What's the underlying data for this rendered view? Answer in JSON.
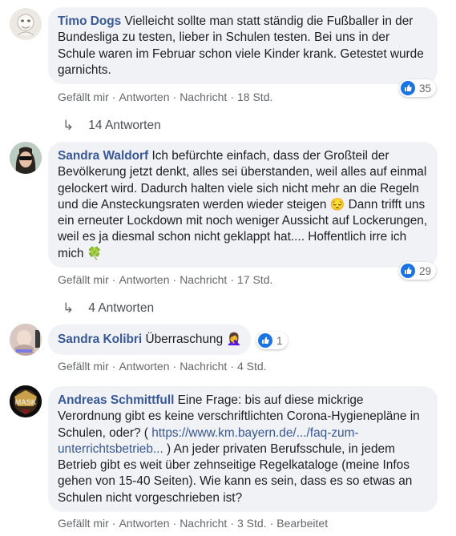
{
  "comments": [
    {
      "author": "Timo Dogs",
      "text": "Vielleicht sollte man statt ständig die Fußballer in der Bundesliga zu testen, lieber in Schulen testen. Bei uns in der Schule waren im Februar schon viele Kinder krank. Getestet wurde garnichts.",
      "like": "Gefällt mir",
      "reply": "Antworten",
      "message": "Nachricht",
      "time": "18 Std.",
      "reactions": "35",
      "replies": "14 Antworten"
    },
    {
      "author": "Sandra Waldorf",
      "text_a": "Ich befürchte einfach, dass der Großteil der Bevölkerung jetzt denkt, alles sei überstanden, weil alles auf einmal gelockert wird. Dadurch halten viele sich nicht mehr an die Regeln und die Ansteckungsraten werden wieder steigen",
      "emoji_a": "😔",
      "text_b": "Dann trifft uns ein erneuter Lockdown mit noch weniger Aussicht auf Lockerungen, weil es ja diesmal schon nicht geklappt hat.... Hoffentlich irre ich mich",
      "emoji_b": "🍀",
      "like": "Gefällt mir",
      "reply": "Antworten",
      "message": "Nachricht",
      "time": "17 Std.",
      "reactions": "29",
      "replies": "4 Antworten"
    },
    {
      "author": "Sandra Kolibri",
      "text": "Überraschung",
      "emoji": "🤦‍♀️",
      "like": "Gefällt mir",
      "reply": "Antworten",
      "message": "Nachricht",
      "time": "4 Std.",
      "reactions": "1"
    },
    {
      "author": "Andreas Schmittfull",
      "text_a": "Eine Frage: bis auf diese mickrige Verordnung gibt es keine verschriftlichten Corona-Hygienepläne in Schulen, oder? (",
      "link": "https://www.km.bayern.de/.../faq-zum-unterrichtsbetrieb...",
      "text_b": ") An jeder privaten Berufsschule, in jedem Betrieb gibt es weit über zehnseitige Regelkataloge (meine Infos gehen von 15-40 Seiten). Wie kann es sein, dass es so etwas an Schulen nicht vorgeschrieben ist?",
      "like": "Gefällt mir",
      "reply": "Antworten",
      "message": "Nachricht",
      "time": "3 Std.",
      "edited": "Bearbeitet"
    }
  ],
  "colors": {
    "author": "#385898",
    "bubble": "#f0f2f5",
    "like": "#1b74e4",
    "meta": "#65676b"
  }
}
